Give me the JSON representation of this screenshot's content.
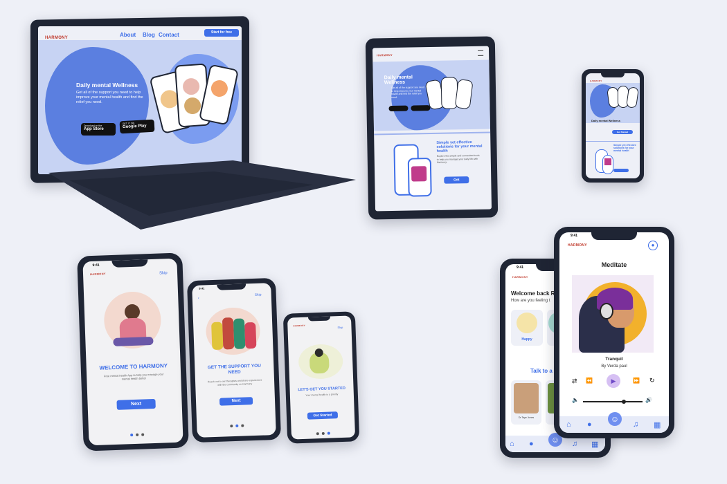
{
  "laptop": {
    "nav": {
      "about": "About",
      "blog": "Blog",
      "contact": "Contact",
      "cta": "Start for free"
    },
    "logo": "HARMONY",
    "hero_title": "Daily mental Wellness",
    "hero_text": "Get all of the support you need to help improve your mental health and find the relief you need.",
    "app_store": {
      "top": "Download on the",
      "main": "App Store"
    },
    "google_play": {
      "top": "GET IT ON",
      "main": "Google Play"
    }
  },
  "tablet": {
    "hero_title": "Daily mental Wellness",
    "hero_text": "Get all of the support you need to help improve your mental health and find the relief you need.",
    "section_title": "Simple yet effective solutions for your mental health",
    "section_text": "Explore the simple and convenient tools to help you manage your daily life with Harmony.",
    "cta": "Get"
  },
  "small_phone": {
    "hero_title": "Daily mental Wellness",
    "section_title": "Simple yet effective solutions for your mental health",
    "cta": "Get Started"
  },
  "onboarding": [
    {
      "time": "9:41",
      "skip": "Skip",
      "title": "WELCOME TO HARMONY",
      "desc": "Free mental health App to help you manage your mental health better",
      "button": "Next"
    },
    {
      "time": "9:41",
      "skip": "Skip",
      "title": "GET THE SUPPORT YOU NEED",
      "desc": "Reach out to our therapists and share experiences with the community on Harmony",
      "button": "Next"
    },
    {
      "time": "9:41",
      "skip": "Skip",
      "title": "LET'S GET YOU STARTED",
      "desc": "Your mental health is a priority",
      "button": "Get Started"
    }
  ],
  "home_phone": {
    "time": "9:41",
    "logo": "HARMONY",
    "welcome": "Welcome back Ru",
    "question": "How are you feeling t",
    "mood": "Happy",
    "talk": "Talk to a",
    "doctor": "Dr Taye Jones",
    "nav": [
      "Home",
      "Community",
      "",
      "Music",
      "Chat"
    ]
  },
  "meditate_phone": {
    "time": "9:41",
    "logo": "HARMONY",
    "title": "Meditate",
    "track": "Tranquil",
    "artist": "By Verda paul",
    "nav": [
      "Home",
      "Community",
      "",
      "Music",
      "Chat"
    ]
  },
  "colors": {
    "accent": "#3f6fe8",
    "frame": "#1f2534",
    "background": "#eef0f7",
    "brand": "#c0392b"
  }
}
